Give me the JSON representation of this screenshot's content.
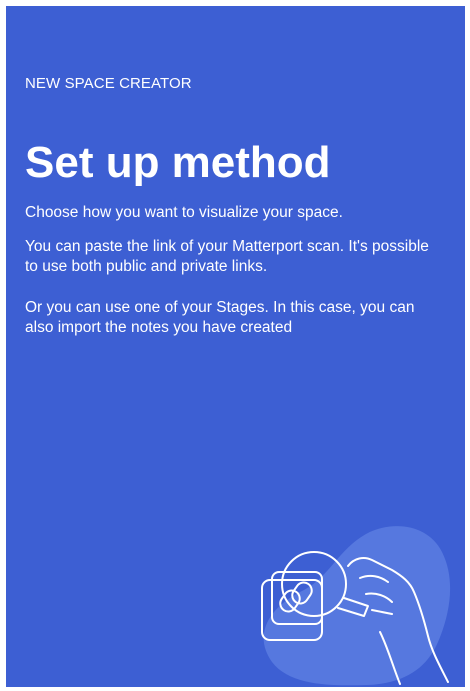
{
  "header": {
    "eyebrow": "NEW SPACE CREATOR",
    "title": "Set up method"
  },
  "content": {
    "intro": "Choose how you want to visualize your space.",
    "matterport": "You can paste the link of your Matterport scan. It's possible to use both public and private links.",
    "stages": "Or you can use one of your Stages. In this case, you can also import the notes you have created"
  },
  "theme": {
    "background": "#3d5fd3",
    "text": "#ffffff",
    "blob": "#5b7ce0"
  },
  "illustration": {
    "icon": "hand-magnifier-link-icon"
  }
}
